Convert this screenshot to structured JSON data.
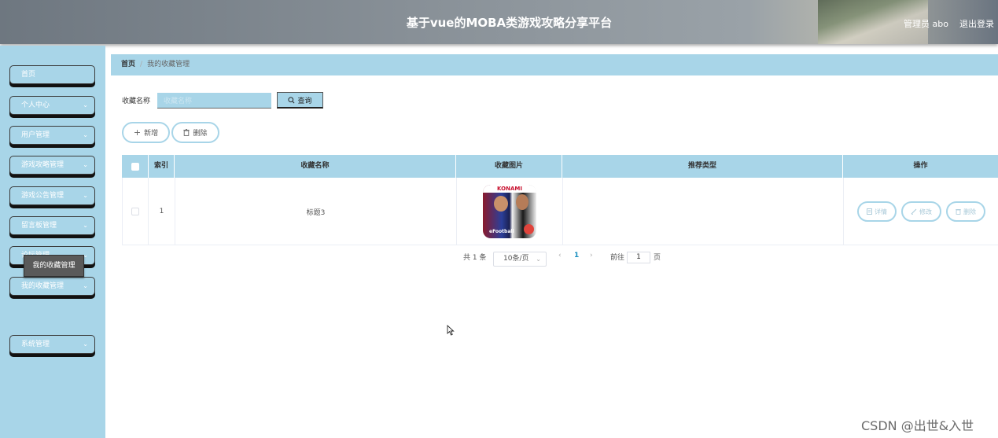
{
  "header": {
    "title": "基于vue的MOBA类游戏攻略分享平台",
    "user": "管理员 abo",
    "logout": "退出登录"
  },
  "sidebar": {
    "items": [
      {
        "label": "首页",
        "has_chevron": false
      },
      {
        "label": "个人中心",
        "has_chevron": true
      },
      {
        "label": "用户管理",
        "has_chevron": true
      },
      {
        "label": "游戏攻略管理",
        "has_chevron": true
      },
      {
        "label": "游戏公告管理",
        "has_chevron": true
      },
      {
        "label": "留言板管理",
        "has_chevron": true
      },
      {
        "label": "论坛管理",
        "has_chevron": true
      },
      {
        "label": "我的收藏管理",
        "has_chevron": true
      },
      {
        "label": "系统管理",
        "has_chevron": true
      }
    ],
    "submenu_item": "我的收藏管理",
    "chevron": "⌄"
  },
  "breadcrumb": {
    "home": "首页",
    "separator": "/",
    "current": "我的收藏管理"
  },
  "search": {
    "label": "收藏名称",
    "placeholder": "收藏名称",
    "value": "",
    "button": "查询"
  },
  "actions": {
    "add": "新增",
    "delete": "删除"
  },
  "table": {
    "columns": [
      "索引",
      "收藏名称",
      "收藏图片",
      "推荐类型",
      "操作"
    ],
    "rows": [
      {
        "index": "1",
        "name": "标题3",
        "image_label": "KONAMI",
        "image_caption": "eFootball",
        "type": "",
        "ops": [
          "详情",
          "修改",
          "删除"
        ]
      }
    ]
  },
  "pagination": {
    "total": "共 1 条",
    "page_size": "10条/页",
    "prev": "‹",
    "current_page": "1",
    "next": "›",
    "goto_label": "前往",
    "goto_value": "1",
    "page_unit": "页"
  },
  "watermark": "CSDN @出世&入世",
  "colors": {
    "accent": "#a8d5e8",
    "header": "#8a9299",
    "menu_border": "#3a3a3a"
  }
}
